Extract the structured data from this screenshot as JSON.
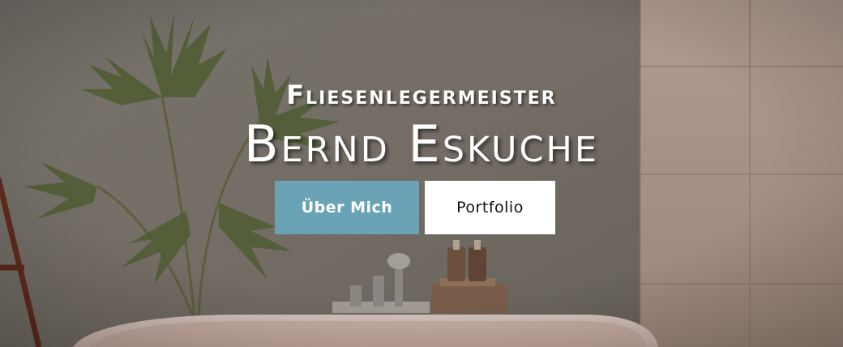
{
  "hero": {
    "subtitle": "Fliesenlegermeister",
    "title": "Bernd Eskuche",
    "buttons": {
      "about_label": "Über Mich",
      "portfolio_label": "Portfolio"
    }
  },
  "colors": {
    "accent": "#6aa3b6",
    "button_secondary_bg": "#ffffff",
    "text_light": "#ffffff"
  }
}
